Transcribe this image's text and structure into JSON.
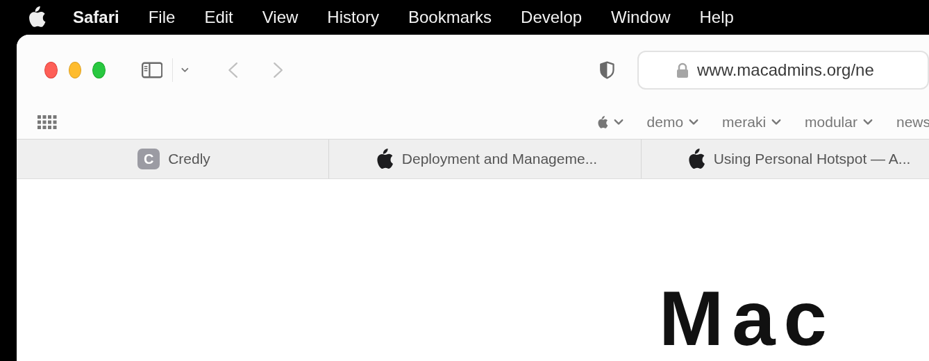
{
  "menu_bar": {
    "app_name": "Safari",
    "items": [
      "File",
      "Edit",
      "View",
      "History",
      "Bookmarks",
      "Develop",
      "Window",
      "Help"
    ]
  },
  "toolbar": {
    "address": "www.macadmins.org/ne"
  },
  "favorites": [
    {
      "kind": "apple"
    },
    {
      "kind": "folder",
      "label": "demo"
    },
    {
      "kind": "folder",
      "label": "meraki"
    },
    {
      "kind": "folder",
      "label": "modular"
    },
    {
      "kind": "plain",
      "label": "news"
    }
  ],
  "tabs": [
    {
      "kind": "letter",
      "icon_text": "C",
      "title": "Credly"
    },
    {
      "kind": "apple",
      "title": "Deployment and Manageme..."
    },
    {
      "kind": "apple",
      "title": "Using Personal Hotspot — A..."
    }
  ],
  "page": {
    "heading": "Mac"
  }
}
